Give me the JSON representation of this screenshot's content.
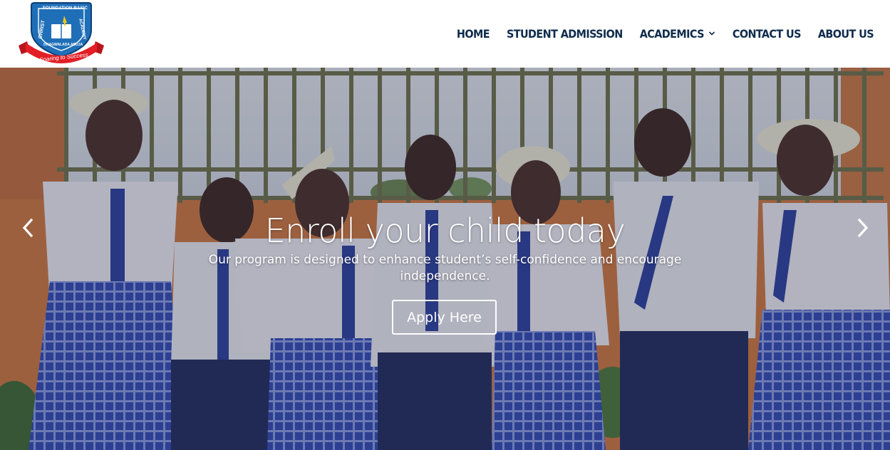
{
  "logo": {
    "top_text": "FOUNDATION BASIC",
    "left_text": "CHRIST",
    "right_text": "ACADEMY",
    "bottom_text": "ONAGWALADA ABUJA",
    "ribbon_text": "Soaring to Success"
  },
  "nav": {
    "items": [
      {
        "label": "HOME"
      },
      {
        "label": "STUDENT ADMISSION"
      },
      {
        "label": "ACADEMICS"
      },
      {
        "label": "CONTACT US"
      },
      {
        "label": "ABOUT US"
      }
    ]
  },
  "hero": {
    "title": "Enroll your child today",
    "subtitle": "Our program is designed to enhance student’s self-confidence and encourage independence.",
    "button_label": "Apply Here",
    "prev_icon": "chevron-left-icon",
    "next_icon": "chevron-right-icon"
  },
  "colors": {
    "nav_text": "#0f2c4c",
    "logo_blue": "#1f6fb8",
    "ribbon_red": "#e21f26",
    "wall_orange": "#d47a3b",
    "uniform_blue": "#2b44a8"
  }
}
